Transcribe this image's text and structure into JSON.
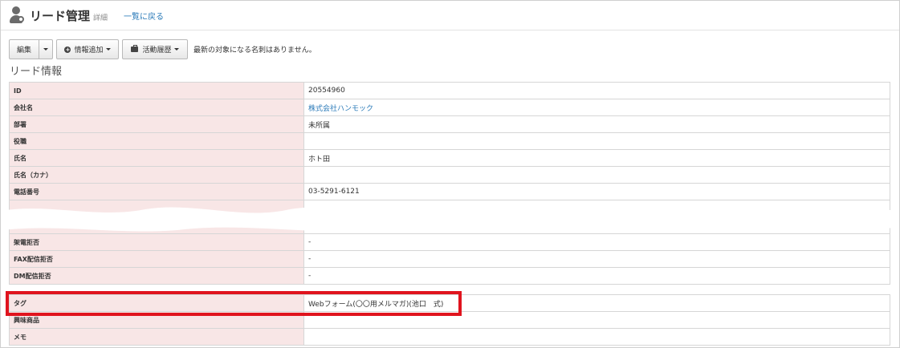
{
  "header": {
    "title": "リード管理",
    "subtitle": "詳細",
    "back_link": "一覧に戻る"
  },
  "toolbar": {
    "edit_label": "編集",
    "add_info_label": "情報追加",
    "activity_label": "活動履歴",
    "notice": "最新の対象になる名刺はありません。"
  },
  "section": {
    "title": "リード情報"
  },
  "rows_top": [
    {
      "label": "ID",
      "value": "20554960"
    },
    {
      "label": "会社名",
      "value": "株式会社ハンモック"
    },
    {
      "label": "部署",
      "value": "未所属"
    },
    {
      "label": "役職",
      "value": ""
    },
    {
      "label": "氏名",
      "value": "ホト田"
    },
    {
      "label": "氏名（カナ）",
      "value": ""
    },
    {
      "label": "電話番号",
      "value": "03-5291-6121"
    },
    {
      "label": "",
      "value": ""
    },
    {
      "label": "",
      "value": ""
    },
    {
      "label": "架電拒否",
      "value": "-"
    },
    {
      "label": "FAX配信拒否",
      "value": "-"
    },
    {
      "label": "DM配信拒否",
      "value": "-"
    }
  ],
  "rows_bottom": [
    {
      "label": "タグ",
      "value": "Webフォーム(〇〇用メルマガ)(池口　式)"
    },
    {
      "label": "興味商品",
      "value": ""
    },
    {
      "label": "メモ",
      "value": ""
    }
  ],
  "colors": {
    "label_bg": "#f8e6e6",
    "link": "#2a7ab8",
    "highlight": "#e0141e"
  }
}
